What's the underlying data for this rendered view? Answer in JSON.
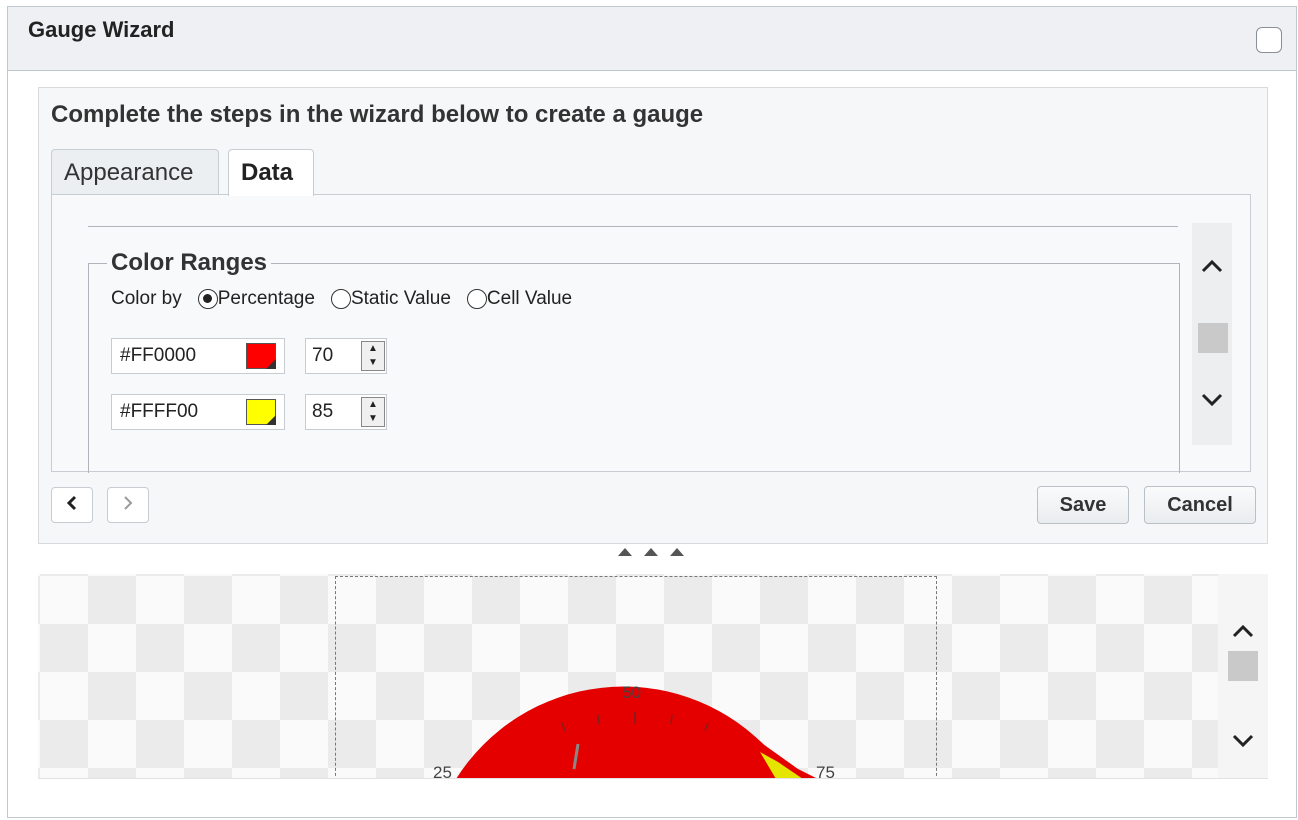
{
  "dialog": {
    "title": "Gauge Wizard"
  },
  "wizard": {
    "intro": "Complete the steps in the wizard below to create a gauge",
    "tabs": [
      {
        "label": "Appearance",
        "active": false
      },
      {
        "label": "Data",
        "active": true
      }
    ],
    "color_ranges": {
      "legend": "Color Ranges",
      "color_by_label": "Color by",
      "options": [
        {
          "label": "Percentage",
          "checked": true
        },
        {
          "label": "Static Value",
          "checked": false
        },
        {
          "label": "Cell Value",
          "checked": false
        }
      ],
      "ranges": [
        {
          "hex": "#FF0000",
          "color": "#FF0000",
          "value": "70"
        },
        {
          "hex": "#FFFF00",
          "color": "#FFFF00",
          "value": "85"
        }
      ]
    },
    "buttons": {
      "save": "Save",
      "cancel": "Cancel"
    }
  },
  "preview": {
    "gauge_labels": [
      "50",
      "25",
      "75"
    ]
  },
  "icons": {
    "prev": "chevron-left-icon",
    "next": "chevron-right-icon",
    "scroll_up": "chevron-up-icon",
    "scroll_down": "chevron-down-icon",
    "splitter": "triangle-up-icons"
  }
}
